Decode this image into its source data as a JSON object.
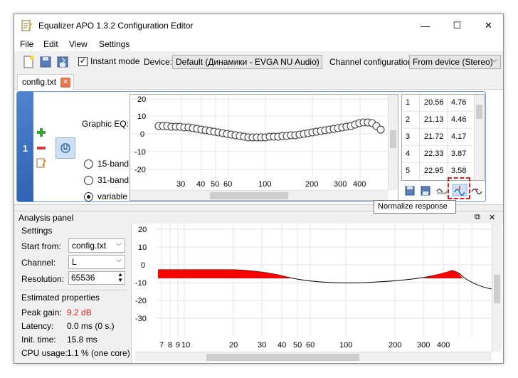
{
  "window": {
    "title": "Equalizer APO 1.3.2 Configuration Editor",
    "minimize": "—",
    "maximize": "☐",
    "close": "✕"
  },
  "menu": [
    "File",
    "Edit",
    "View",
    "Settings"
  ],
  "toolbar": {
    "instant_mode_label": "Instant mode",
    "instant_mode_checked": true,
    "checkmark": "✓",
    "device_label": "Device:",
    "device_value": "Default (Динамики - EVGA NU Audio)",
    "channel_config_label": "Channel configuration:",
    "channel_config_value": "From device (Stereo)"
  },
  "tab": {
    "label": "config.txt",
    "close": "✕"
  },
  "filter": {
    "index": "1",
    "type_label": "Graphic EQ:",
    "band_options": [
      "15-band",
      "31-band",
      "variable"
    ],
    "selected_band": "variable",
    "graph_y_ticks": [
      "20",
      "10",
      "0",
      "-10",
      "-20"
    ],
    "graph_x_ticks": [
      "30",
      "40",
      "50",
      "60",
      "100",
      "200",
      "300",
      "400"
    ],
    "table_rows": [
      {
        "n": "1",
        "freq": "20.56",
        "gain": "4.76"
      },
      {
        "n": "2",
        "freq": "21.13",
        "gain": "4.46"
      },
      {
        "n": "3",
        "freq": "21.72",
        "gain": "4.17"
      },
      {
        "n": "4",
        "freq": "22.33",
        "gain": "3.87"
      },
      {
        "n": "5",
        "freq": "22.95",
        "gain": "3.58"
      }
    ]
  },
  "tooltip": "Normalize response",
  "analysis": {
    "title": "Analysis panel",
    "settings_header": "Settings",
    "start_from_label": "Start from:",
    "start_from_value": "config.txt",
    "channel_label": "Channel:",
    "channel_value": "L",
    "resolution_label": "Resolution:",
    "resolution_value": "65536",
    "estimated_header": "Estimated properties",
    "peak_gain_label": "Peak gain:",
    "peak_gain_value": "9.2 dB",
    "latency_label": "Latency:",
    "latency_value": "0.0 ms (0 s.)",
    "init_time_label": "Init. time:",
    "init_time_value": "15.8 ms",
    "cpu_label": "CPU usage:",
    "cpu_value": "1.1 % (one core)",
    "graph_y_ticks": [
      "20",
      "10",
      "0",
      "-10",
      "-20",
      "-30"
    ],
    "graph_x_ticks": [
      "7",
      "8",
      "9",
      "10",
      "20",
      "30",
      "40",
      "50",
      "60",
      "100",
      "200",
      "300",
      "400"
    ]
  },
  "colors": {
    "accent": "#2f64b3",
    "peak": "#e02020",
    "fill": "#ff0000"
  }
}
